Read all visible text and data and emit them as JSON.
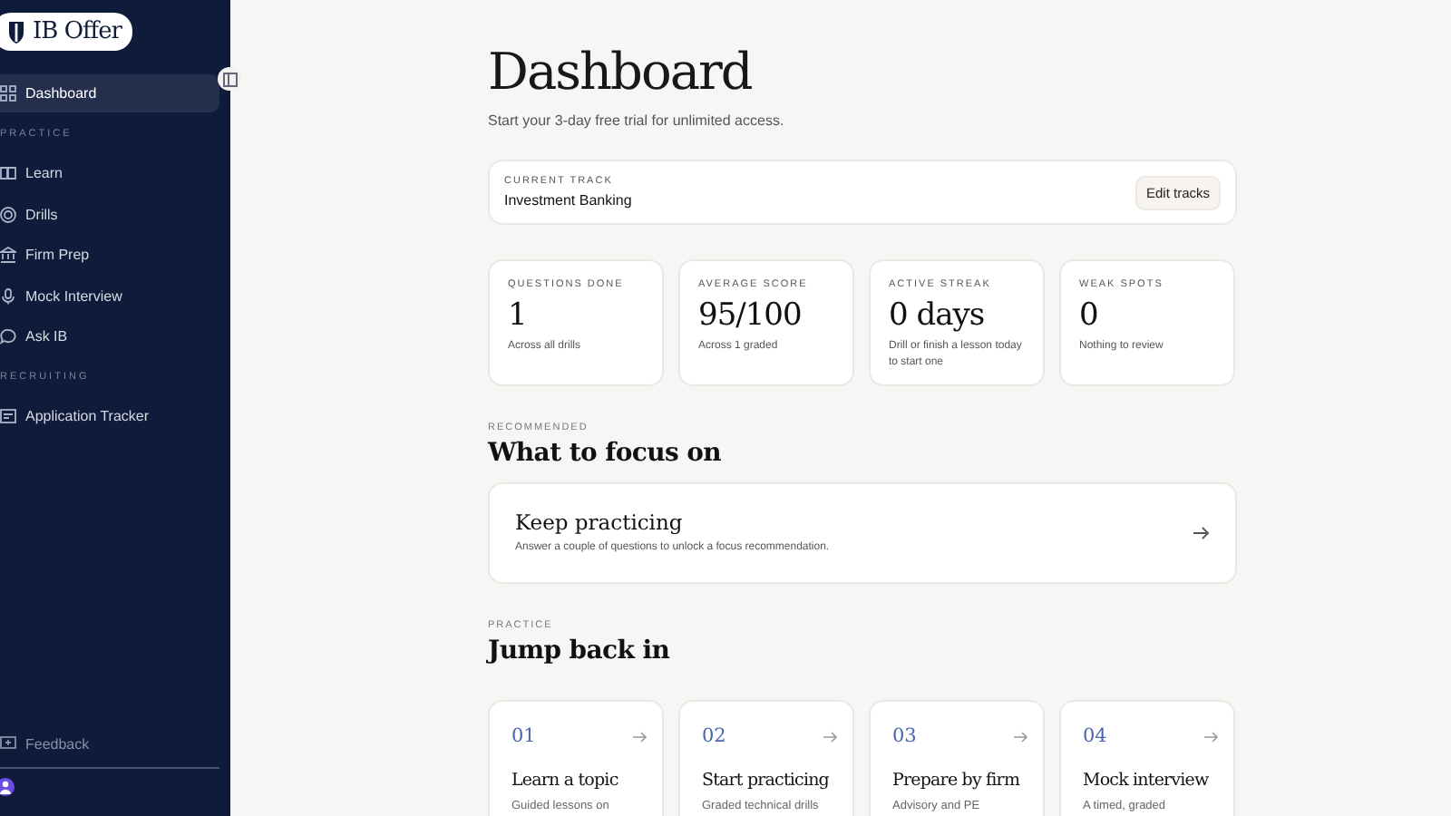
{
  "sidebar": {
    "logo": "IB Offer",
    "items": [
      {
        "kind": "item",
        "label": "Dashboard",
        "selected": true
      },
      {
        "kind": "section",
        "label": "PRACTICE"
      },
      {
        "kind": "item",
        "label": "Learn",
        "selected": false
      },
      {
        "kind": "item",
        "label": "Drills",
        "selected": false
      },
      {
        "kind": "item",
        "label": "Firm Prep",
        "selected": false
      },
      {
        "kind": "item",
        "label": "Mock Interview",
        "selected": false
      },
      {
        "kind": "item",
        "label": "Ask IB",
        "selected": false
      },
      {
        "kind": "section",
        "label": "RECRUITING"
      },
      {
        "kind": "item",
        "label": "Application Tracker",
        "selected": false
      }
    ],
    "feedback": "Feedback"
  },
  "header": {
    "title": "Dashboard",
    "subtitle": "Start your 3-day free trial for unlimited access."
  },
  "track": {
    "label": "CURRENT TRACK",
    "value": "Investment Banking",
    "button": "Edit tracks"
  },
  "stats": [
    {
      "label": "QUESTIONS DONE",
      "value": "1",
      "note": "Across all drills"
    },
    {
      "label": "AVERAGE SCORE",
      "value": "95/100",
      "note": "Across 1 graded"
    },
    {
      "label": "ACTIVE STREAK",
      "value": "0 days",
      "note": "Drill or finish a lesson today to start one"
    },
    {
      "label": "WEAK SPOTS",
      "value": "0",
      "note": "Nothing to review"
    }
  ],
  "focus": {
    "eyebrow": "RECOMMENDED",
    "heading": "What to focus on",
    "title": "Keep practicing",
    "text": "Answer a couple of questions to unlock a focus recommendation."
  },
  "jump": {
    "eyebrow": "PRACTICE",
    "heading": "Jump back in",
    "cards": [
      {
        "number": "01",
        "title": "Learn a topic",
        "text": "Guided lessons on"
      },
      {
        "number": "02",
        "title": "Start practicing",
        "text": "Graded technical drills"
      },
      {
        "number": "03",
        "title": "Prepare by firm",
        "text": "Advisory and PE"
      },
      {
        "number": "04",
        "title": "Mock interview",
        "text": "A timed, graded"
      }
    ]
  }
}
